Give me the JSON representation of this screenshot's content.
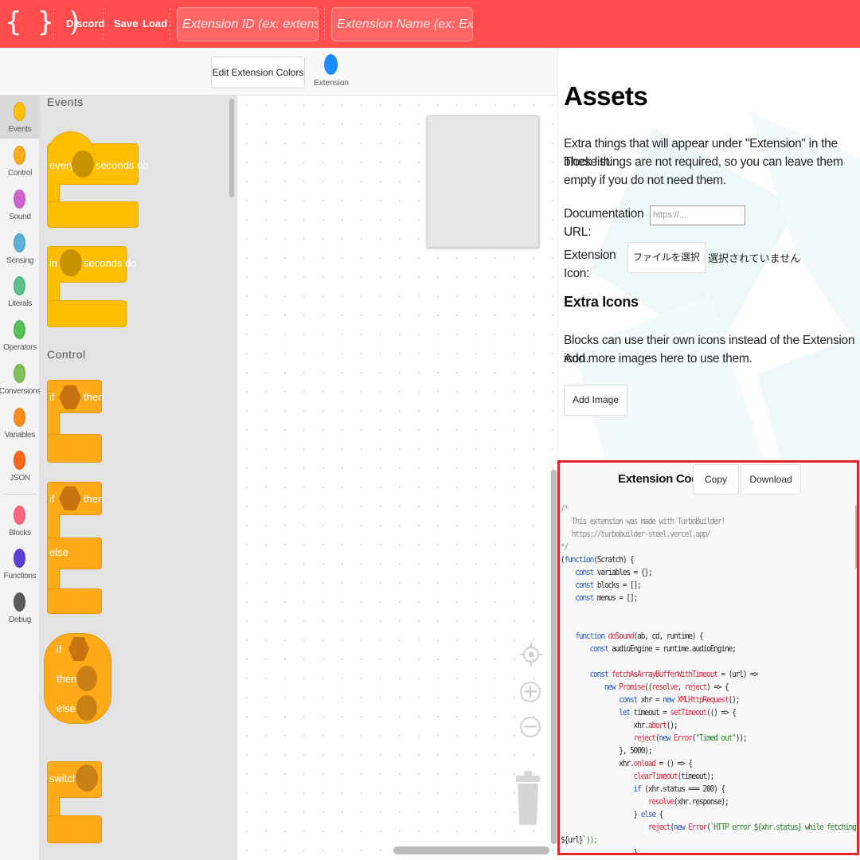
{
  "topbar": {
    "logo": "{ } )",
    "discord": "Discord",
    "save": "Save",
    "load": "Load",
    "extension_id_placeholder": "Extension ID (ex: extensionID)",
    "extension_name_placeholder": "Extension Name (ex: Extension)"
  },
  "editor_header": {
    "colors_button": "Edit Extension Colors",
    "extension_label": "Extension",
    "extension_color": "#1a8cff"
  },
  "categories": [
    {
      "label": "Events",
      "color": "#ffbf00",
      "active": true
    },
    {
      "label": "Control",
      "color": "#ffab19"
    },
    {
      "label": "Sound",
      "color": "#cf63cf"
    },
    {
      "label": "Sensing",
      "color": "#5cb1d6"
    },
    {
      "label": "Literals",
      "color": "#59c08a"
    },
    {
      "label": "Operators",
      "color": "#59c059"
    },
    {
      "label": "Conversions",
      "color": "#7fbf5a"
    },
    {
      "label": "Variables",
      "color": "#ff8c1a"
    },
    {
      "label": "JSON",
      "color": "#ff661a"
    },
    {
      "label": "Blocks",
      "color": "#ff6680"
    },
    {
      "label": "Functions",
      "color": "#5e3fd6"
    },
    {
      "label": "Debug",
      "color": "#5a5a5a"
    }
  ],
  "flyout": {
    "events_heading": "Events",
    "control_heading": "Control",
    "every_block": {
      "word1": "every",
      "word2": "seconds do"
    },
    "in_block": {
      "word1": "in",
      "word2": "seconds do"
    },
    "if_then": {
      "word1": "if",
      "word2": "then"
    },
    "if_else": {
      "word1": "if",
      "word2": "then",
      "word3": "else"
    },
    "ternary": {
      "word1": "if",
      "word2": "then",
      "word3": "else"
    },
    "switch_block": {
      "word1": "switch"
    }
  },
  "assets": {
    "title": "Assets",
    "description_line1": "Extra things that will appear under \"Extension\" in the block list.",
    "description_line2": "These things are not required, so you can leave them empty if you do not need them.",
    "doc_url_label": "Documentation URL:",
    "doc_url_placeholder": "https://...",
    "icon_label": "Extension Icon:",
    "file_button": "ファイルを選択",
    "file_status": "選択されていません",
    "extra_icons_title": "Extra Icons",
    "extra_icons_line1": "Blocks can use their own icons instead of the Extension icon.",
    "extra_icons_line2": "Add more images here to use them.",
    "add_image_button": "Add Image"
  },
  "code_panel": {
    "title": "Extension Code",
    "copy_button": "Copy",
    "download_button": "Download",
    "lines": [
      "/*",
      "   This extension was made with TurboBuilder!",
      "   https://turbobuilder-steel.vercel.app/",
      "*/",
      "(function(Scratch) {",
      "    const variables = {};",
      "    const blocks = [];",
      "    const menus = [];",
      "",
      "",
      "    function doSound(ab, cd, runtime) {",
      "        const audioEngine = runtime.audioEngine;",
      "",
      "        const fetchAsArrayBufferWithTimeout = (url) =>",
      "            new Promise((resolve, reject) => {",
      "                const xhr = new XMLHttpRequest();",
      "                let timeout = setTimeout(() => {",
      "                    xhr.abort();",
      "                    reject(new Error(\"Timed out\"));",
      "                }, 5000);",
      "                xhr.onload = () => {",
      "                    clearTimeout(timeout);",
      "                    if (xhr.status === 200) {",
      "                        resolve(xhr.response);",
      "                    } else {",
      "                        reject(new Error(`HTTP error ${xhr.status} while fetching",
      "${url}`));",
      "                    }"
    ]
  }
}
